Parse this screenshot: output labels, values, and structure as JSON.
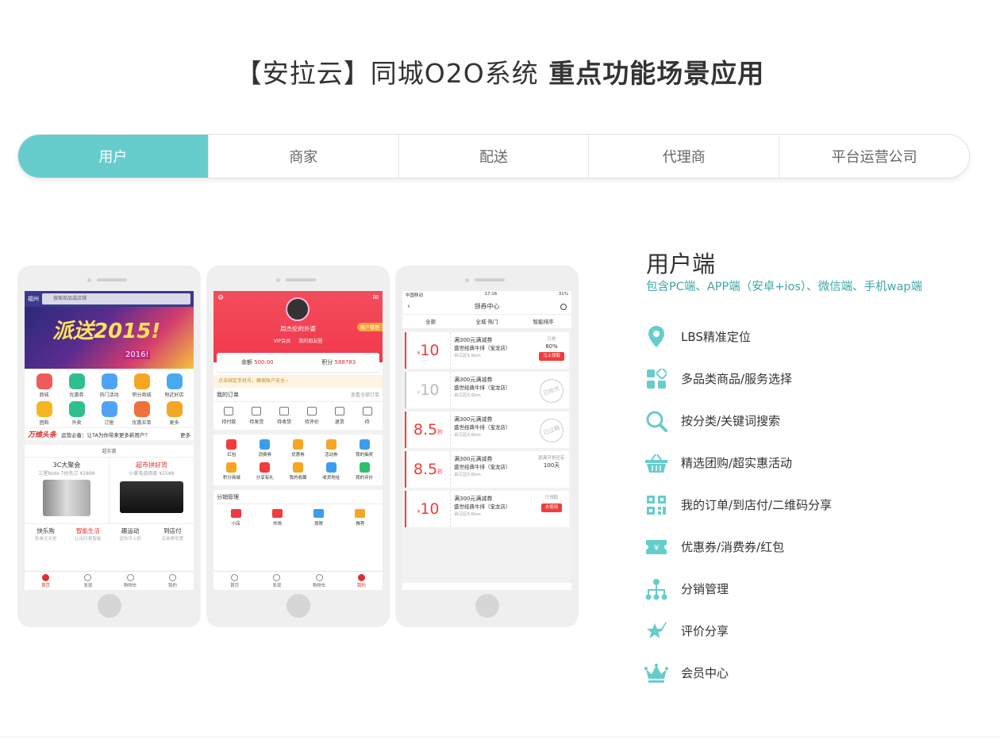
{
  "header": {
    "title_part1": "【安拉云】同城O2O系统",
    "title_part2": " 重点功能场景应用"
  },
  "tabs": [
    {
      "label": "用户",
      "active": true
    },
    {
      "label": "商家",
      "active": false
    },
    {
      "label": "配送",
      "active": false
    },
    {
      "label": "代理商",
      "active": false
    },
    {
      "label": "平台运营公司",
      "active": false
    }
  ],
  "colors": {
    "accent": "#66cdcc",
    "accent_text": "#3fa6a6",
    "phone_red": "#f03c3c"
  },
  "phone1": {
    "city": "福州",
    "search_placeholder": "搜索商品或店铺",
    "banner_text": "派送2015!",
    "banner_year": "2016!",
    "icons": [
      {
        "label": "商城",
        "color": "#ef5b5b"
      },
      {
        "label": "优惠券",
        "color": "#2fbf8f"
      },
      {
        "label": "热门活动",
        "color": "#4ea3f5"
      },
      {
        "label": "积分商城",
        "color": "#f5a623"
      },
      {
        "label": "附近好店",
        "color": "#49a9f0"
      },
      {
        "label": "团购",
        "color": "#f5b623"
      },
      {
        "label": "外卖",
        "color": "#2fbf8f"
      },
      {
        "label": "订座",
        "color": "#4ea3f5"
      },
      {
        "label": "优惠买单",
        "color": "#f2703a"
      },
      {
        "label": "更多",
        "color": "#f5a623"
      }
    ],
    "news_logo": "万维头条",
    "news_text": "运营必备：让TA为你带来更多新用户？",
    "news_more": "更多",
    "deal_label": "超实惠",
    "products": [
      {
        "title": "3C大聚会",
        "sub": "三星Note 7抢先订 ¥2899"
      },
      {
        "title": "超市拼好货",
        "sub": "小家电游奇款 ¥2588"
      }
    ],
    "cats": [
      {
        "title": "快乐购",
        "sub": "免单天天抢"
      },
      {
        "title": "智能生活",
        "sub": "让出行更智能"
      },
      {
        "title": "趣运动",
        "sub": "逗你乐上折"
      },
      {
        "title": "到店付",
        "sub": "买单更优惠"
      }
    ],
    "nav": [
      "首页",
      "发现",
      "购物车",
      "我的"
    ]
  },
  "phone2": {
    "name": "周杰伦的外婆",
    "vip": "VIP会员",
    "friends": "我的朋友圈",
    "manage": "账户管理",
    "balance_label": "余额",
    "balance": "500.00",
    "points_label": "积分",
    "points": "588783",
    "warn": "点击绑定手机号，确保账户安全~",
    "orders_title": "我的订单",
    "orders_more": "查看全部订单",
    "order_items": [
      "待付款",
      "待发货",
      "待收货",
      "待评价",
      "退货",
      "待"
    ],
    "grid": [
      {
        "label": "红包",
        "color": "#f03c3c"
      },
      {
        "label": "消费券",
        "color": "#3c9cf0"
      },
      {
        "label": "优惠券",
        "color": "#f5a623"
      },
      {
        "label": "活动券",
        "color": "#f5a623"
      },
      {
        "label": "我的抽奖",
        "color": "#3c9cf0"
      },
      {
        "label": "积分商城",
        "color": "#f5a623"
      },
      {
        "label": "分享有礼",
        "color": "#f03c3c"
      },
      {
        "label": "我的收藏",
        "color": "#f5a623"
      },
      {
        "label": "收货地址",
        "color": "#3c9cf0"
      },
      {
        "label": "我的评价",
        "color": "#2fbf6f"
      }
    ],
    "dist_title": "分销管理",
    "dist": [
      {
        "label": "小店",
        "color": "#f03c3c"
      },
      {
        "label": "市场",
        "color": "#f03c3c"
      },
      {
        "label": "揽税",
        "color": "#3c9cf0"
      },
      {
        "label": "推荐",
        "color": "#f5a623"
      }
    ],
    "nav": [
      "首页",
      "发现",
      "购物车",
      "我的"
    ]
  },
  "phone3": {
    "carrier": "中国移动",
    "time": "17:16",
    "battery": "31%",
    "title": "领券中心",
    "filters": [
      "全部",
      "全城·热门",
      "智能排序"
    ],
    "coupons": [
      {
        "amount": "10",
        "cur": "¥",
        "unit": "",
        "title": "满300元满减券",
        "shop": "盛世经典牛排（宝龙店）",
        "dist": "台江区5.6km",
        "status1": "已抢",
        "status2": "80%",
        "button": "马上领取",
        "stamp": "",
        "gray": false
      },
      {
        "amount": "10",
        "cur": "¥",
        "unit": "",
        "title": "满300元满减券",
        "shop": "盛世经典牛排（宝龙店）",
        "dist": "台江区5.6km",
        "status1": "",
        "status2": "",
        "button": "",
        "stamp": "已抢光",
        "gray": true
      },
      {
        "amount": "8.5",
        "cur": "",
        "unit": "折",
        "title": "满300元满减券",
        "shop": "盛世经典牛排（宝龙店）",
        "dist": "台江区5.6km",
        "status1": "",
        "status2": "",
        "button": "",
        "stamp": "已过期",
        "gray": false
      },
      {
        "amount": "8.5",
        "cur": "",
        "unit": "折",
        "title": "满300元满减券",
        "shop": "盛世经典牛排（宝龙店）",
        "dist": "台江区5.6km",
        "status1": "距离开抢还有",
        "status2": "100天",
        "button": "",
        "stamp": "",
        "gray": false
      },
      {
        "amount": "10",
        "cur": "¥",
        "unit": "",
        "title": "满300元满减券",
        "shop": "盛世经典牛排（宝龙店）",
        "dist": "台江区5.6km",
        "status1": "已领取",
        "status2": "",
        "button": "去使用",
        "stamp": "",
        "gray": false
      }
    ]
  },
  "features": {
    "title": "用户端",
    "subtitle": "包含PC端、APP端（安卓+ios）、微信端、手机wap端",
    "items": [
      {
        "label": "LBS精准定位",
        "icon": "location-pin-icon"
      },
      {
        "label": "多品类商品/服务选择",
        "icon": "category-grid-icon"
      },
      {
        "label": "按分类/关键词搜索",
        "icon": "search-icon"
      },
      {
        "label": "精选团购/超实惠活动",
        "icon": "basket-icon"
      },
      {
        "label": "我的订单/到店付/二维码分享",
        "icon": "qrcode-icon"
      },
      {
        "label": "优惠券/消费券/红包",
        "icon": "coupon-icon"
      },
      {
        "label": "分销管理",
        "icon": "distribution-tree-icon"
      },
      {
        "label": "评价分享",
        "icon": "star-pen-icon"
      },
      {
        "label": "会员中心",
        "icon": "crown-icon"
      }
    ]
  }
}
